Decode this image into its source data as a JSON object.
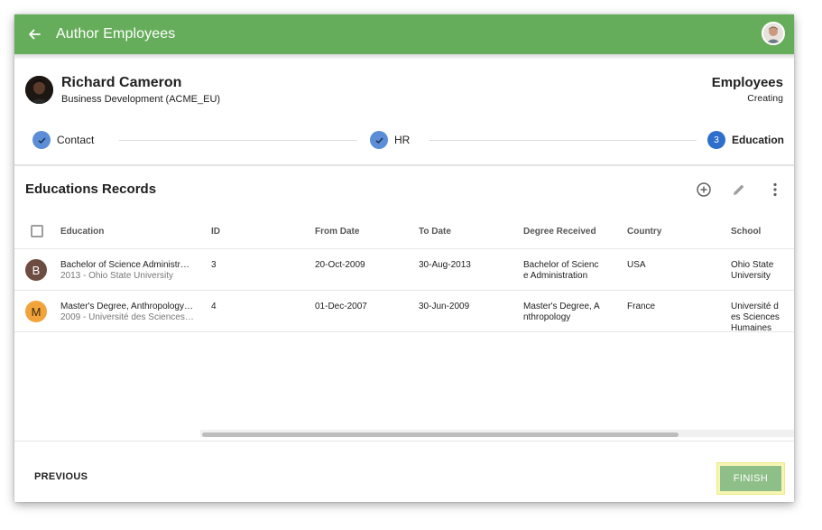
{
  "header": {
    "title": "Author Employees",
    "back_icon": "arrow-left-icon",
    "user_avatar_icon": "user-avatar"
  },
  "person": {
    "name": "Richard Cameron",
    "department": "Business Development (ACME_EU)"
  },
  "module": {
    "title": "Employees",
    "status": "Creating"
  },
  "stepper": {
    "steps": [
      {
        "label": "Contact",
        "state": "done"
      },
      {
        "label": "HR",
        "state": "done"
      },
      {
        "number": "3",
        "label": "Education",
        "state": "active"
      }
    ]
  },
  "section": {
    "title": "Educations Records"
  },
  "table": {
    "columns": [
      "Education",
      "ID",
      "From Date",
      "To Date",
      "Degree Received",
      "Country",
      "School"
    ],
    "rows": [
      {
        "avatar_letter": "B",
        "avatar_color": "#6d4c41",
        "education": "Bachelor of Science Administr…",
        "education_sub": "2013 - Ohio State University",
        "id": "3",
        "from_date": "20-Oct-2009",
        "to_date": "30-Aug-2013",
        "degree": "Bachelor of Science Administration",
        "country": "USA",
        "school": "Ohio State University"
      },
      {
        "avatar_letter": "M",
        "avatar_color": "#f2a33a",
        "education": "Master's Degree, Anthropology…",
        "education_sub": "2009 - Université des Sciences …",
        "id": "4",
        "from_date": "01-Dec-2007",
        "to_date": "30-Jun-2009",
        "degree": "Master's Degree, Anthropology",
        "country": "France",
        "school": "Université des Sciences Humaines"
      }
    ]
  },
  "footer": {
    "previous_label": "PREVIOUS",
    "finish_label": "FINISH"
  },
  "colors": {
    "appbar": "#66ad5b",
    "step": "#5b8ed6",
    "step_active": "#2f6fcc",
    "finish": "#8fbf88",
    "highlight": "#f6f6b2"
  }
}
